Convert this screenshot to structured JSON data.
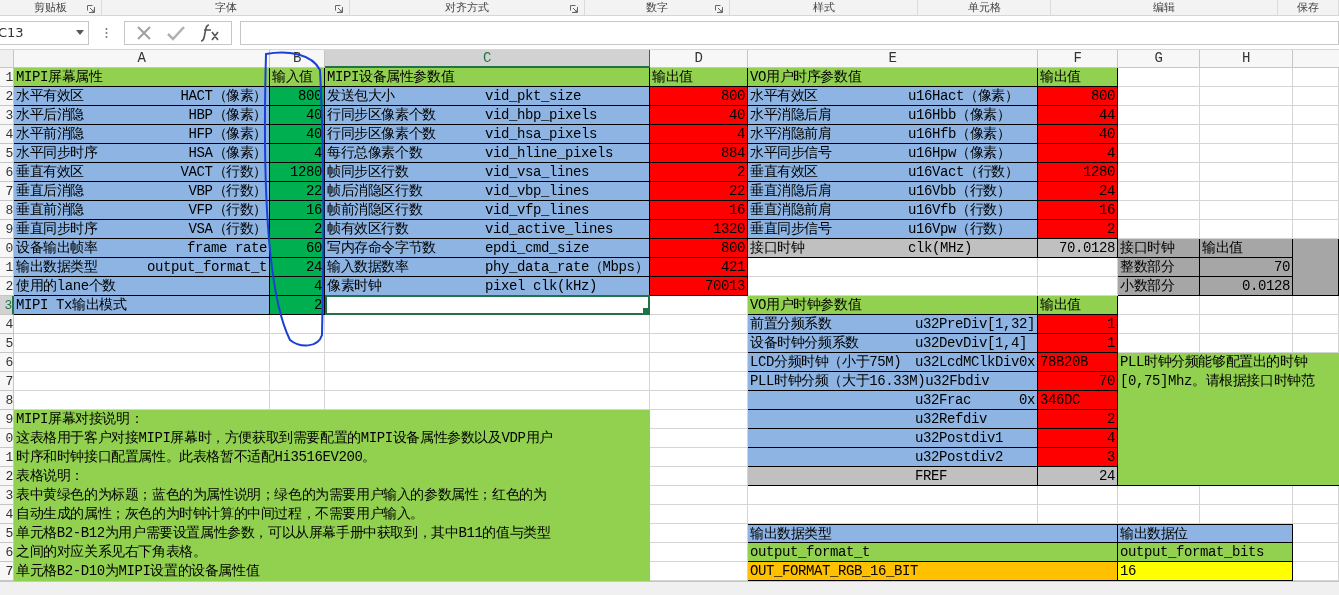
{
  "ribbon_groups": [
    {
      "label": "剪贴板",
      "launcher": true
    },
    {
      "label": "字体",
      "launcher": true
    },
    {
      "label": "对齐方式",
      "launcher": true
    },
    {
      "label": "数字",
      "launcher": true
    },
    {
      "label": "样式",
      "launcher": false
    },
    {
      "label": "单元格",
      "launcher": false
    },
    {
      "label": "编辑",
      "launcher": false
    },
    {
      "label": "保存",
      "launcher": false
    }
  ],
  "formula_bar": {
    "name_box": "C13"
  },
  "column_headers": [
    {
      "label": "A",
      "selected": false
    },
    {
      "label": "B",
      "selected": false
    },
    {
      "label": "C",
      "selected": true
    },
    {
      "label": "D",
      "selected": false
    },
    {
      "label": "E",
      "selected": false
    },
    {
      "label": "F",
      "selected": false
    },
    {
      "label": "G",
      "selected": false
    },
    {
      "label": "H",
      "selected": false
    }
  ],
  "row_headers": [
    {
      "label": "1",
      "selected": false
    },
    {
      "label": "2",
      "selected": false
    },
    {
      "label": "3",
      "selected": false
    },
    {
      "label": "4",
      "selected": false
    },
    {
      "label": "5",
      "selected": false
    },
    {
      "label": "6",
      "selected": false
    },
    {
      "label": "7",
      "selected": false
    },
    {
      "label": "8",
      "selected": false
    },
    {
      "label": "9",
      "selected": false
    },
    {
      "label": "0",
      "selected": false
    },
    {
      "label": "1",
      "selected": false
    },
    {
      "label": "2",
      "selected": false
    },
    {
      "label": "3",
      "selected": true
    },
    {
      "label": "4",
      "selected": false
    },
    {
      "label": "5",
      "selected": false
    },
    {
      "label": "6",
      "selected": false
    },
    {
      "label": "7",
      "selected": false
    },
    {
      "label": "8",
      "selected": false
    },
    {
      "label": "9",
      "selected": false
    },
    {
      "label": "0",
      "selected": false
    },
    {
      "label": "1",
      "selected": false
    },
    {
      "label": "2",
      "selected": false
    },
    {
      "label": "3",
      "selected": false
    },
    {
      "label": "4",
      "selected": false
    },
    {
      "label": "5",
      "selected": false
    },
    {
      "label": "6",
      "selected": false
    },
    {
      "label": "7",
      "selected": false
    }
  ],
  "screen_table": {
    "title": "MIPI屏幕属性",
    "value_header": "输入值",
    "rows": [
      {
        "name": "水平有效区",
        "param": "HACT（像素）",
        "value": "800"
      },
      {
        "name": "水平后消隐",
        "param": "HBP（像素）",
        "value": "40"
      },
      {
        "name": "水平前消隐",
        "param": "HFP（像素）",
        "value": "40"
      },
      {
        "name": "水平同步时序",
        "param": "HSA（像素）",
        "value": "4"
      },
      {
        "name": "垂直有效区",
        "param": "VACT（行数）",
        "value": "1280"
      },
      {
        "name": "垂直后消隐",
        "param": "VBP（行数）",
        "value": "22"
      },
      {
        "name": "垂直前消隐",
        "param": "VFP（行数）",
        "value": "16"
      },
      {
        "name": "垂直同步时序",
        "param": "VSA（行数）",
        "value": "2"
      },
      {
        "name": "设备输出帧率",
        "param": "frame rate",
        "value": "60"
      },
      {
        "name": "输出数据类型",
        "param": "output_format_t",
        "value": "24"
      },
      {
        "name": "使用的lane个数",
        "value": "4"
      },
      {
        "name": "MIPI Tx输出模式",
        "value": "2"
      }
    ]
  },
  "device_table": {
    "title": "MIPI设备属性参数值",
    "value_header": "输出值",
    "rows": [
      {
        "name": "发送包大小",
        "param": "vid_pkt_size",
        "value": "800"
      },
      {
        "name": "行同步区像素个数",
        "param": "vid_hbp_pixels",
        "value": "40"
      },
      {
        "name": "行同步区像素个数",
        "param": "vid_hsa_pixels",
        "value": "4"
      },
      {
        "name": "每行总像素个数",
        "param": "vid_hline_pixels",
        "value": "884"
      },
      {
        "name": "帧同步区行数",
        "param": "vid_vsa_lines",
        "value": "2"
      },
      {
        "name": "帧后消隐区行数",
        "param": "vid_vbp_lines",
        "value": "22"
      },
      {
        "name": "帧前消隐区行数",
        "param": "vid_vfp_lines",
        "value": "16"
      },
      {
        "name": "帧有效区行数",
        "param": "vid_active_lines",
        "value": "1320"
      },
      {
        "name": "写内存命令字节数",
        "param": "epdi_cmd_size",
        "value": "800"
      },
      {
        "name": "输入数据数率",
        "param": "phy_data_rate（Mbps）",
        "value": "421"
      },
      {
        "name": "像素时钟",
        "param": "pixel clk(kHz)",
        "value": "70013"
      }
    ]
  },
  "timing_table": {
    "title": "VO用户时序参数值",
    "value_header": "输出值",
    "rows": [
      {
        "name": "水平有效区",
        "param": "u16Hact（像素）",
        "value": "800"
      },
      {
        "name": "水平消隐后肩",
        "param": "u16Hbb（像素）",
        "value": "44"
      },
      {
        "name": "水平消隐前肩",
        "param": "u16Hfb（像素）",
        "value": "40"
      },
      {
        "name": "水平同步信号",
        "param": "u16Hpw（像素）",
        "value": "4"
      },
      {
        "name": "垂直有效区",
        "param": "u16Vact（行数）",
        "value": "1280"
      },
      {
        "name": "垂直消隐后肩",
        "param": "u16Vbb（行数）",
        "value": "24"
      },
      {
        "name": "垂直消隐前肩",
        "param": "u16Vfb（行数）",
        "value": "16"
      },
      {
        "name": "垂直同步信号",
        "param": "u16Vpw（行数）",
        "value": "2"
      }
    ],
    "clock_row": {
      "name": "接口时钟",
      "param": "clk(MHz)",
      "value": "70.0128"
    }
  },
  "clock_split": {
    "headers": [
      "接口时钟",
      "输出值"
    ],
    "rows": [
      {
        "name": "整数部分",
        "value": "70"
      },
      {
        "name": "小数部分",
        "value": "0.0128"
      }
    ]
  },
  "clock_table": {
    "title": "VO用户时钟参数值",
    "value_header": "输出值",
    "rows": [
      {
        "kind": "number",
        "name": "前置分频系数",
        "param": "u32PreDiv[1,32]",
        "value": "1"
      },
      {
        "kind": "number",
        "name": "设备时钟分频系数",
        "param": "u32DevDiv[1,4]",
        "value": "1"
      },
      {
        "kind": "hex",
        "name": "LCD分频时钟（小于75M)",
        "param": "u32LcdMClkDiv",
        "suffix": "0x",
        "value": "78B20B"
      },
      {
        "kind": "number",
        "name": "PLL时钟分频（大于16.33M)",
        "param": "u32Fbdiv",
        "value": "70"
      },
      {
        "kind": "hex",
        "param": "u32Frac",
        "suffix": "0x",
        "value": "346DC"
      },
      {
        "kind": "number",
        "param": "u32Refdiv",
        "value": "2"
      },
      {
        "kind": "number",
        "param": "u32Postdiv1",
        "value": "4"
      },
      {
        "kind": "number",
        "param": "u32Postdiv2",
        "value": "3"
      },
      {
        "kind": "reference",
        "param": "FREF",
        "value": "24"
      }
    ]
  },
  "pll_note": {
    "lines": [
      "PLL时钟分频能够配置出的时钟",
      "[0,75]Mhz。请根据接口时钟范"
    ]
  },
  "notes": [
    {
      "lines": [
        "MIPI屏幕对接说明："
      ]
    },
    {
      "lines": [
        "这表格用于客户对接MIPI屏幕时，方便获取到需要配置的MIPI设备属性参数以及VDP用户",
        "时序和时钟接口配置属性。此表格暂不适配Hi3516EV200。"
      ]
    },
    {
      "lines": [
        "表格说明："
      ]
    },
    {
      "lines": [
        "表中黄绿色的为标题；蓝色的为属性说明；绿色的为需要用户输入的参数属性；红色的为",
        "自动生成的属性；灰色的为时钟计算的中间过程，不需要用户输入。"
      ]
    },
    {
      "lines": [
        "单元格B2-B12为用户需要设置属性参数，可以从屏幕手册中获取到，其中B11的值与类型",
        "之间的对应关系见右下角表格。"
      ]
    },
    {
      "lines": [
        "单元格B2-D10为MIPI设置的设备属性值"
      ]
    }
  ],
  "output_type_table": {
    "headers": [
      "输出数据类型",
      "输出数据位"
    ],
    "subheaders": [
      "output_format_t",
      "output_format_bits"
    ],
    "rows": [
      {
        "type": "OUT_FORMAT_RGB_16_BIT",
        "bits": "16"
      }
    ]
  }
}
